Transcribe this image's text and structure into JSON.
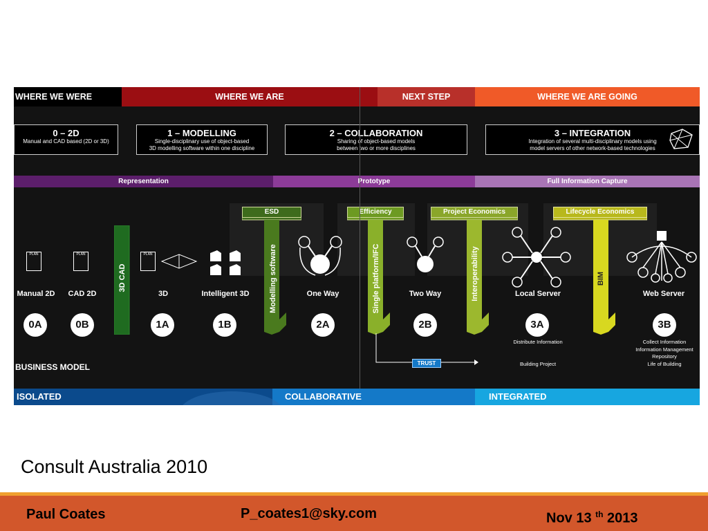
{
  "headers": {
    "where_we_were": "WHERE WE WERE",
    "where_we_are": "WHERE WE ARE",
    "next_step": "NEXT STEP",
    "where_going": "WHERE WE ARE GOING"
  },
  "stages": {
    "s0": {
      "title": "0 – 2D",
      "sub": "Manual and CAD based (2D or 3D)"
    },
    "s1": {
      "title": "1 – MODELLING",
      "sub1": "Single-disciplinary use of object-based",
      "sub2": "3D modelling software within one discipline"
    },
    "s2": {
      "title": "2 – COLLABORATION",
      "sub1": "Sharing of object-based models",
      "sub2": "between two or more disciplines"
    },
    "s3": {
      "title": "3 – INTEGRATION",
      "sub1": "Integration of several multi-disciplinary models using",
      "sub2": "model servers of other network-based technologies"
    }
  },
  "bands": {
    "representation": "Representation",
    "prototype": "Prototype",
    "full_capture": "Full Information Capture"
  },
  "vertical_labels": {
    "cad3d": "3D CAD",
    "modelling_software": "Modelling software",
    "single_platform": "Single platform/IFC",
    "interoperability": "Interoperability",
    "bim": "BIM"
  },
  "top_labels": {
    "esd": "ESD",
    "efficiency": "Efficiency",
    "project_economics": "Project Economics",
    "lifecycle_economics": "Lifecycle Economics"
  },
  "icons": {
    "plan": "PLAN"
  },
  "captions": {
    "manual2d": "Manual 2D",
    "cad2d": "CAD 2D",
    "d3": "3D",
    "intelligent3d": "Intelligent 3D",
    "one_way": "One Way",
    "two_way": "Two Way",
    "local_server": "Local Server",
    "web_server": "Web Server"
  },
  "badges": {
    "b0a": "0A",
    "b0b": "0B",
    "b1a": "1A",
    "b1b": "1B",
    "b2a": "2A",
    "b2b": "2B",
    "b3a": "3A",
    "b3b": "3B"
  },
  "notes": {
    "distribute": "Distribute Information",
    "building_project": "Building Project",
    "collect": "Collect Information",
    "info_mgmt": "Information Management",
    "repository": "Repository",
    "life_building": "Life of Building"
  },
  "trust": "TRUST",
  "business_model": "BUSINESS MODEL",
  "bottom": {
    "isolated": "ISOLATED",
    "collaborative": "COLLABORATIVE",
    "integrated": "INTEGRATED"
  },
  "caption": "Consult Australia 2010",
  "footer": {
    "author": "Paul Coates",
    "email": "P_coates1@sky.com",
    "date_prefix": "Nov 13 ",
    "date_sup": "th",
    "date_suffix": " 2013"
  },
  "colors": {
    "dark_red": "#9b0e12",
    "red": "#b8302a",
    "orange": "#f05a28",
    "purple_dark": "#5c1e6b",
    "purple_mid": "#8c3b98",
    "purple_light": "#a874b5",
    "green_dark": "#1f6b20",
    "olive": "#5a7a1a",
    "lime": "#8ab02a",
    "yellow": "#d8d820",
    "blue_dark": "#0b4a8c",
    "blue_mid": "#1479c8",
    "blue_light": "#17a6e0",
    "footer_bg": "#d2572b",
    "footer_line": "#f0a030"
  }
}
